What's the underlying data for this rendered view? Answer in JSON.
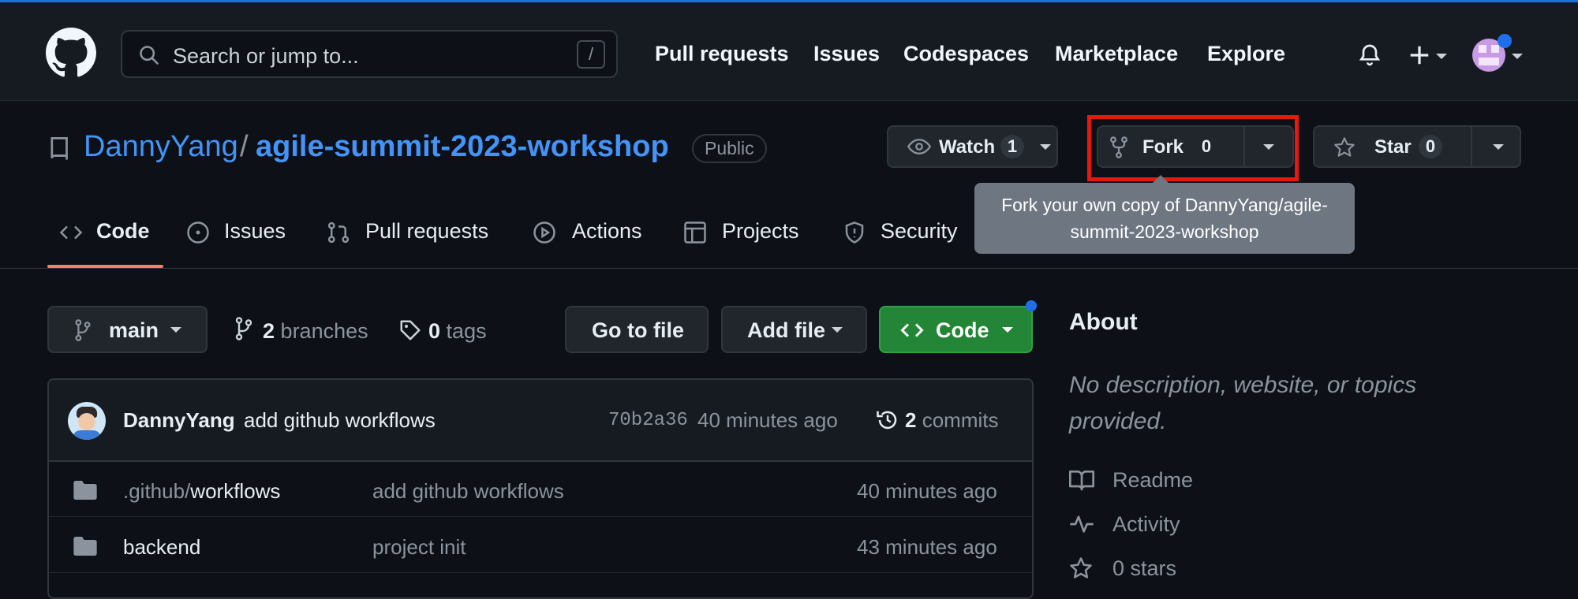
{
  "header": {
    "search_placeholder": "Search or jump to...",
    "search_shortcut": "/",
    "nav": [
      "Pull requests",
      "Issues",
      "Codespaces",
      "Marketplace",
      "Explore"
    ]
  },
  "repo": {
    "owner": "DannyYang",
    "separator": "/",
    "name": "agile-summit-2023-workshop",
    "visibility": "Public",
    "watch_label": "Watch",
    "watch_count": "1",
    "fork_label": "Fork",
    "fork_count": "0",
    "star_label": "Star",
    "star_count": "0"
  },
  "tooltip": {
    "line1": "Fork your own copy of DannyYang/agile-",
    "line2": "summit-2023-workshop"
  },
  "tabs": [
    "Code",
    "Issues",
    "Pull requests",
    "Actions",
    "Projects",
    "Security"
  ],
  "toolbar": {
    "branch": "main",
    "branches_count": "2",
    "branches_label": "branches",
    "tags_count": "0",
    "tags_label": "tags",
    "go_to_file": "Go to file",
    "add_file": "Add file",
    "code": "Code"
  },
  "commit": {
    "author": "DannyYang",
    "message": "add github workflows",
    "sha": "70b2a36",
    "time": "40 minutes ago",
    "commits_count": "2",
    "commits_label": "commits"
  },
  "files": [
    {
      "name_prefix": ".github/",
      "name_main": "workflows",
      "message": "add github workflows",
      "time": "40 minutes ago"
    },
    {
      "name_prefix": "",
      "name_main": "backend",
      "message": "project init",
      "time": "43 minutes ago"
    }
  ],
  "about": {
    "heading": "About",
    "description": "No description, website, or topics provided.",
    "items": [
      "Readme",
      "Activity",
      "0 stars"
    ]
  },
  "colors": {
    "accent": "#4493f8",
    "primary_button": "#238636",
    "highlight_box": "#e3190f",
    "tab_underline": "#f78166"
  }
}
